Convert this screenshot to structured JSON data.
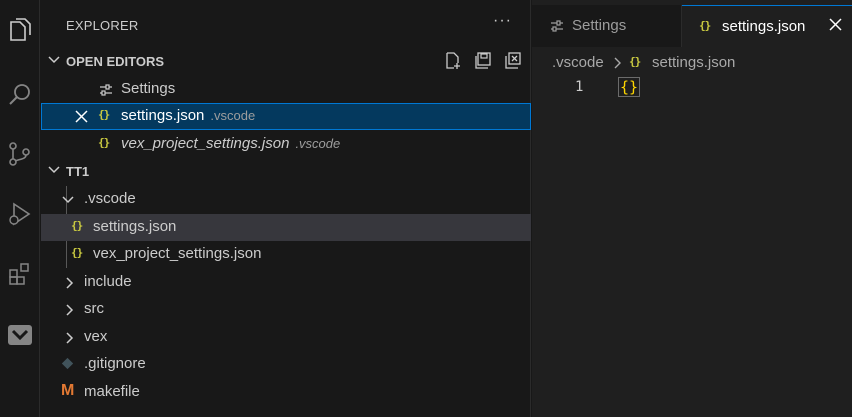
{
  "sidebar": {
    "title": "EXPLORER",
    "more_actions": "···",
    "open_editors": {
      "label": "OPEN EDITORS",
      "items": [
        {
          "name": "Settings",
          "desc": "",
          "icon": "settings-icon"
        },
        {
          "name": "settings.json",
          "desc": ".vscode",
          "icon": "json-icon",
          "active": true
        },
        {
          "name": "vex_project_settings.json",
          "desc": ".vscode",
          "icon": "json-icon",
          "preview": true
        }
      ]
    },
    "project": {
      "label": "TT1",
      "tree": [
        {
          "name": ".vscode",
          "type": "folder",
          "expanded": true
        },
        {
          "name": "settings.json",
          "type": "json"
        },
        {
          "name": "vex_project_settings.json",
          "type": "json"
        },
        {
          "name": "include",
          "type": "folder"
        },
        {
          "name": "src",
          "type": "folder"
        },
        {
          "name": "vex",
          "type": "folder"
        },
        {
          "name": ".gitignore",
          "type": "git"
        },
        {
          "name": "makefile",
          "type": "makefile"
        }
      ]
    }
  },
  "json_glyph": "{}",
  "makefile_glyph": "M",
  "editor": {
    "tabs": [
      {
        "label": "Settings",
        "active": false
      },
      {
        "label": "settings.json",
        "active": true
      }
    ],
    "breadcrumb": [
      ".vscode",
      "settings.json"
    ],
    "lines": [
      {
        "number": "1",
        "content": "{}"
      }
    ]
  },
  "colors": {
    "accent": "#0078d4",
    "json_icon": "#cbcb41",
    "makefile_icon": "#e37933",
    "bracket": "#ffd700",
    "active_row": "#04395e"
  }
}
